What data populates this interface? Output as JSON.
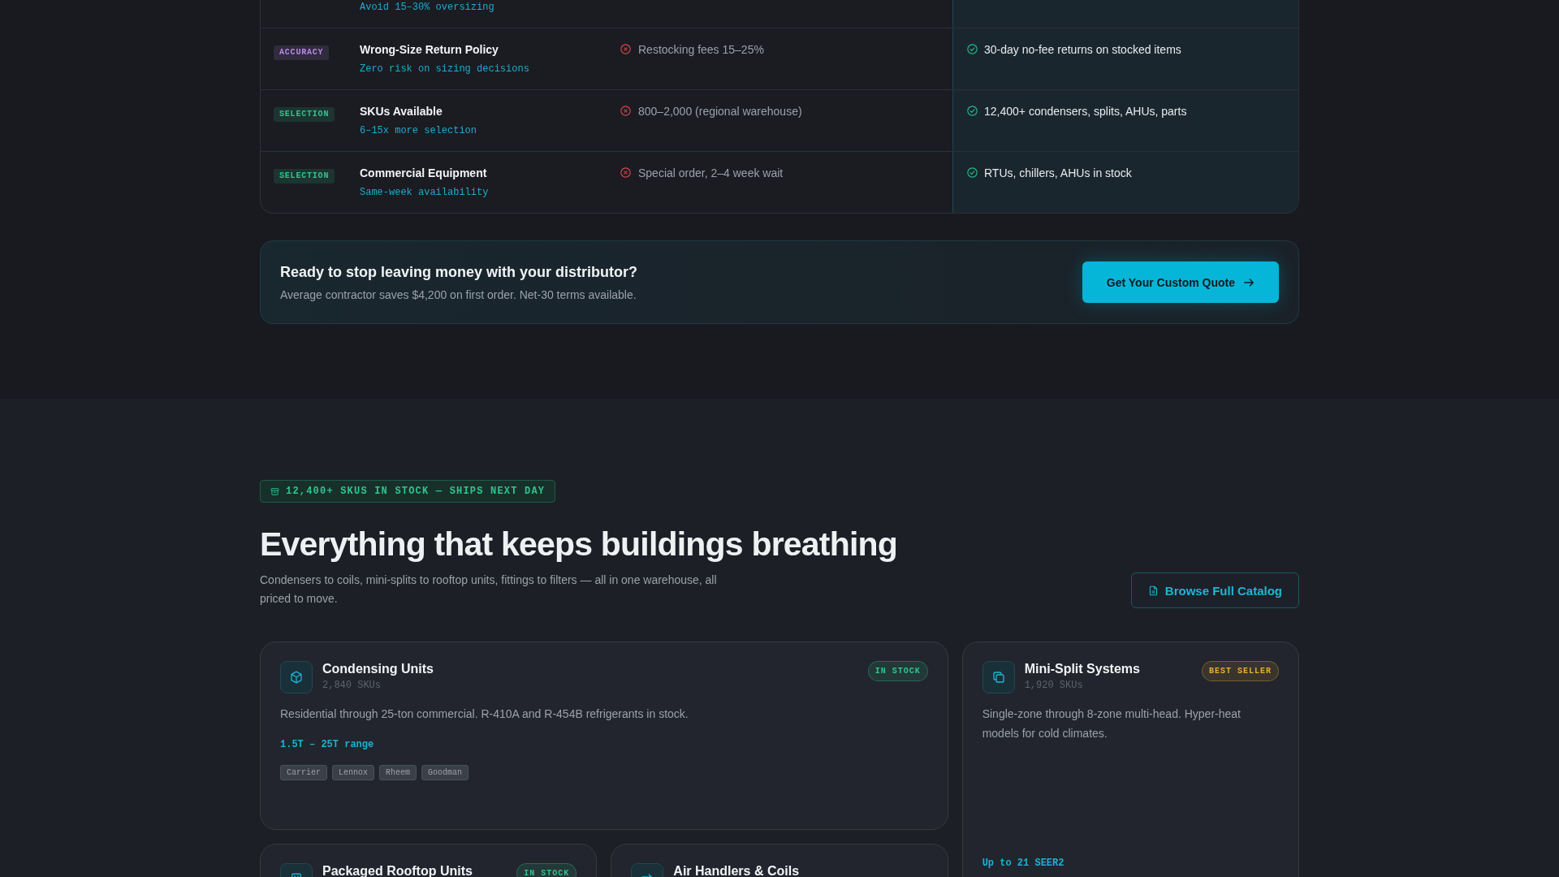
{
  "comparison_table": {
    "rows": [
      {
        "subtitle": "Avoid 15–30% oversizing"
      },
      {
        "tag": {
          "label": "ACCURACY",
          "color": "#b98ae8"
        },
        "title": "Wrong-Size Return Policy",
        "subtitle": "Zero risk on sizing decisions",
        "competitor": "Restocking fees 15–25%",
        "ours": "30-day no-fee returns on stocked items"
      },
      {
        "tag": {
          "label": "SELECTION",
          "color": "#2fc58c"
        },
        "title": "SKUs Available",
        "subtitle": "6–15x more selection",
        "competitor": "800–2,000 (regional warehouse)",
        "ours": "12,400+ condensers, splits, AHUs, parts"
      },
      {
        "tag": {
          "label": "SELECTION",
          "color": "#2fc58c"
        },
        "title": "Commercial Equipment",
        "subtitle": "Same-week availability",
        "competitor": "Special order, 2–4 week wait",
        "ours": "RTUs, chillers, AHUs in stock"
      }
    ]
  },
  "cta": {
    "title": "Ready to stop leaving money with your distributor?",
    "text": "Average contractor saves $4,200 on first order. Net-30 terms available.",
    "button": "Get Your Custom Quote"
  },
  "catalog": {
    "badge": "12,400+ SKUS IN STOCK — SHIPS NEXT DAY",
    "title": "Everything that keeps buildings breathing",
    "text": "Condensers to coils, mini-splits to rooftop units, fittings to filters — all in one warehouse, all priced to move.",
    "button": "Browse Full Catalog",
    "cards": [
      {
        "title": "Condensing Units",
        "skus": "2,840 SKUs",
        "badge": {
          "label": "IN STOCK",
          "color": "#2fc58c"
        },
        "text": "Residential through 25-ton commercial. R-410A and R-454B refrigerants in stock.",
        "spec": "1.5T – 25T range",
        "brands": [
          "Carrier",
          "Lennox",
          "Rheem",
          "Goodman"
        ]
      },
      {
        "title": "Mini-Split Systems",
        "skus": "1,920 SKUs",
        "badge": {
          "label": "BEST SELLER",
          "color": "#e8ad32"
        },
        "text": "Single-zone through 8-zone multi-head. Hyper-heat models for cold climates.",
        "spec": "Up to 21 SEER2"
      },
      {
        "title": "Packaged Rooftop Units",
        "badge": {
          "label": "IN STOCK",
          "color": "#2fc58c"
        }
      },
      {
        "title": "Air Handlers & Coils"
      }
    ]
  }
}
